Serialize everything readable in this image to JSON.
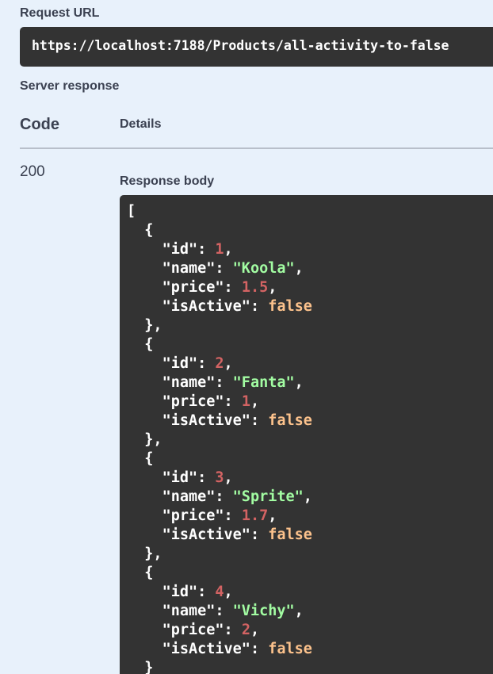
{
  "request_url": {
    "label": "Request URL",
    "value": "https://localhost:7188/Products/all-activity-to-false"
  },
  "server_response": {
    "label": "Server response",
    "columns": {
      "code": "Code",
      "details": "Details"
    },
    "status_code": "200",
    "response_body_label": "Response body",
    "colors": {
      "key": "#ffffff",
      "number": "#d36363",
      "string": "#a2fca2",
      "boolean": "#fcc28c",
      "background": "#333333"
    },
    "open_bracket": "[",
    "items": [
      {
        "id": "1",
        "name": "\"Koola\"",
        "price": "1.5",
        "isActive": "false"
      },
      {
        "id": "2",
        "name": "\"Fanta\"",
        "price": "1",
        "isActive": "false"
      },
      {
        "id": "3",
        "name": "\"Sprite\"",
        "price": "1.7",
        "isActive": "false"
      },
      {
        "id": "4",
        "name": "\"Vichy\"",
        "price": "2",
        "isActive": "false"
      }
    ],
    "trailing_brace": "}"
  }
}
